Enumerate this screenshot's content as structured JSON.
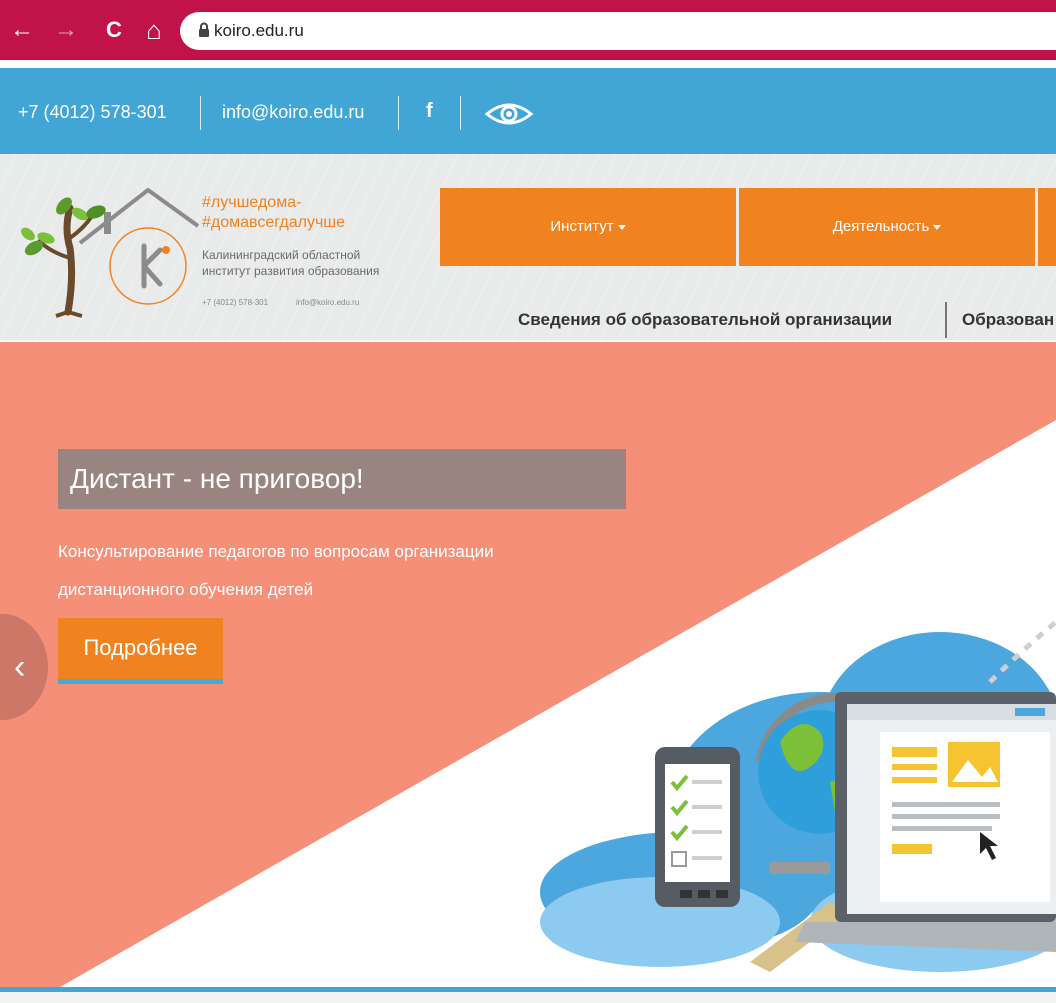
{
  "browser": {
    "url": "koiro.edu.ru",
    "back_glyph": "←",
    "forward_glyph": "→",
    "reload_glyph": "C",
    "home_glyph": "⌂"
  },
  "topbar": {
    "phone": "+7 (4012) 578-301",
    "email": "info@koiro.edu.ru",
    "facebook_glyph": "f",
    "accessibility_icon": "eye-icon"
  },
  "logo": {
    "hashtag_line1": "#лучшедома-",
    "hashtag_line2": "#домавсегдалучше",
    "name_line1": "Калининградский областной",
    "name_line2": "институт развития образования",
    "phone": "+7 (4012) 578-301",
    "email": "info@koiro.edu.ru"
  },
  "menu": {
    "items": [
      {
        "label": "Институт"
      },
      {
        "label": "Деятельность"
      }
    ],
    "submenu": {
      "item1": "Сведения об образовательной организации",
      "item2": "Образован"
    }
  },
  "slide": {
    "title": "Дистант - не приговор!",
    "desc_line1": "Консультирование педагогов по вопросам организации",
    "desc_line2": "дистанционного обучения детей",
    "button_label": "Подробнее",
    "prev_glyph": "‹"
  },
  "colors": {
    "browser_bar": "#c2124a",
    "topbar": "#41a6d6",
    "accent_orange": "#f0821f",
    "slide_bg": "#f58f78"
  }
}
